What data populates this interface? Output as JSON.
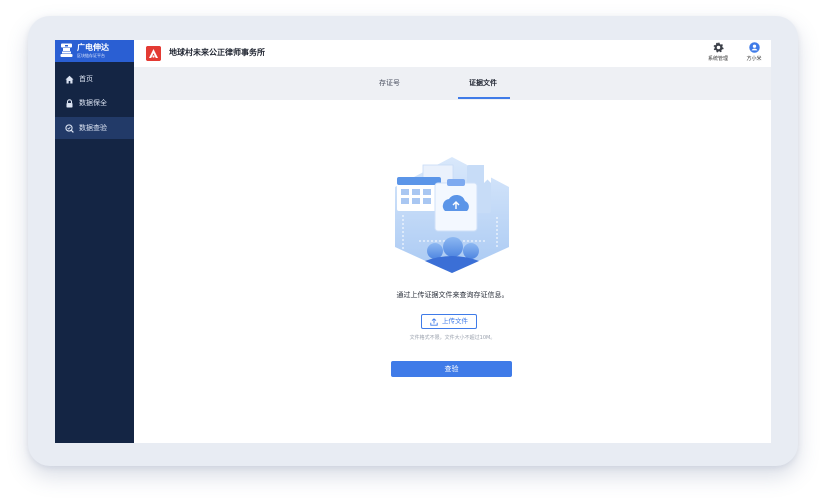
{
  "brand": {
    "name": "广电伸达",
    "subtitle": "区块链存证平台"
  },
  "sidebar": {
    "items": [
      {
        "label": "首页",
        "icon": "home-icon",
        "active": false
      },
      {
        "label": "数据保全",
        "icon": "lock-icon",
        "active": false
      },
      {
        "label": "数据查验",
        "icon": "search-check-icon",
        "active": true
      }
    ]
  },
  "header": {
    "org_title": "地球村未来公正律师事务所",
    "system_label": "系统管理",
    "user_name": "方小米"
  },
  "tabs": [
    {
      "label": "存证号",
      "active": false
    },
    {
      "label": "证据文件",
      "active": true
    }
  ],
  "main": {
    "description": "通过上传证据文件来查询存证信息。",
    "upload_label": "上传文件",
    "hint": "文件格式不限，文件大小不超过10M。",
    "verify_label": "查验"
  },
  "colors": {
    "accent": "#3f7be8",
    "sidebar_bg": "#142544",
    "brand_bg": "#2a5fd3",
    "logo_red": "#e33a33"
  }
}
